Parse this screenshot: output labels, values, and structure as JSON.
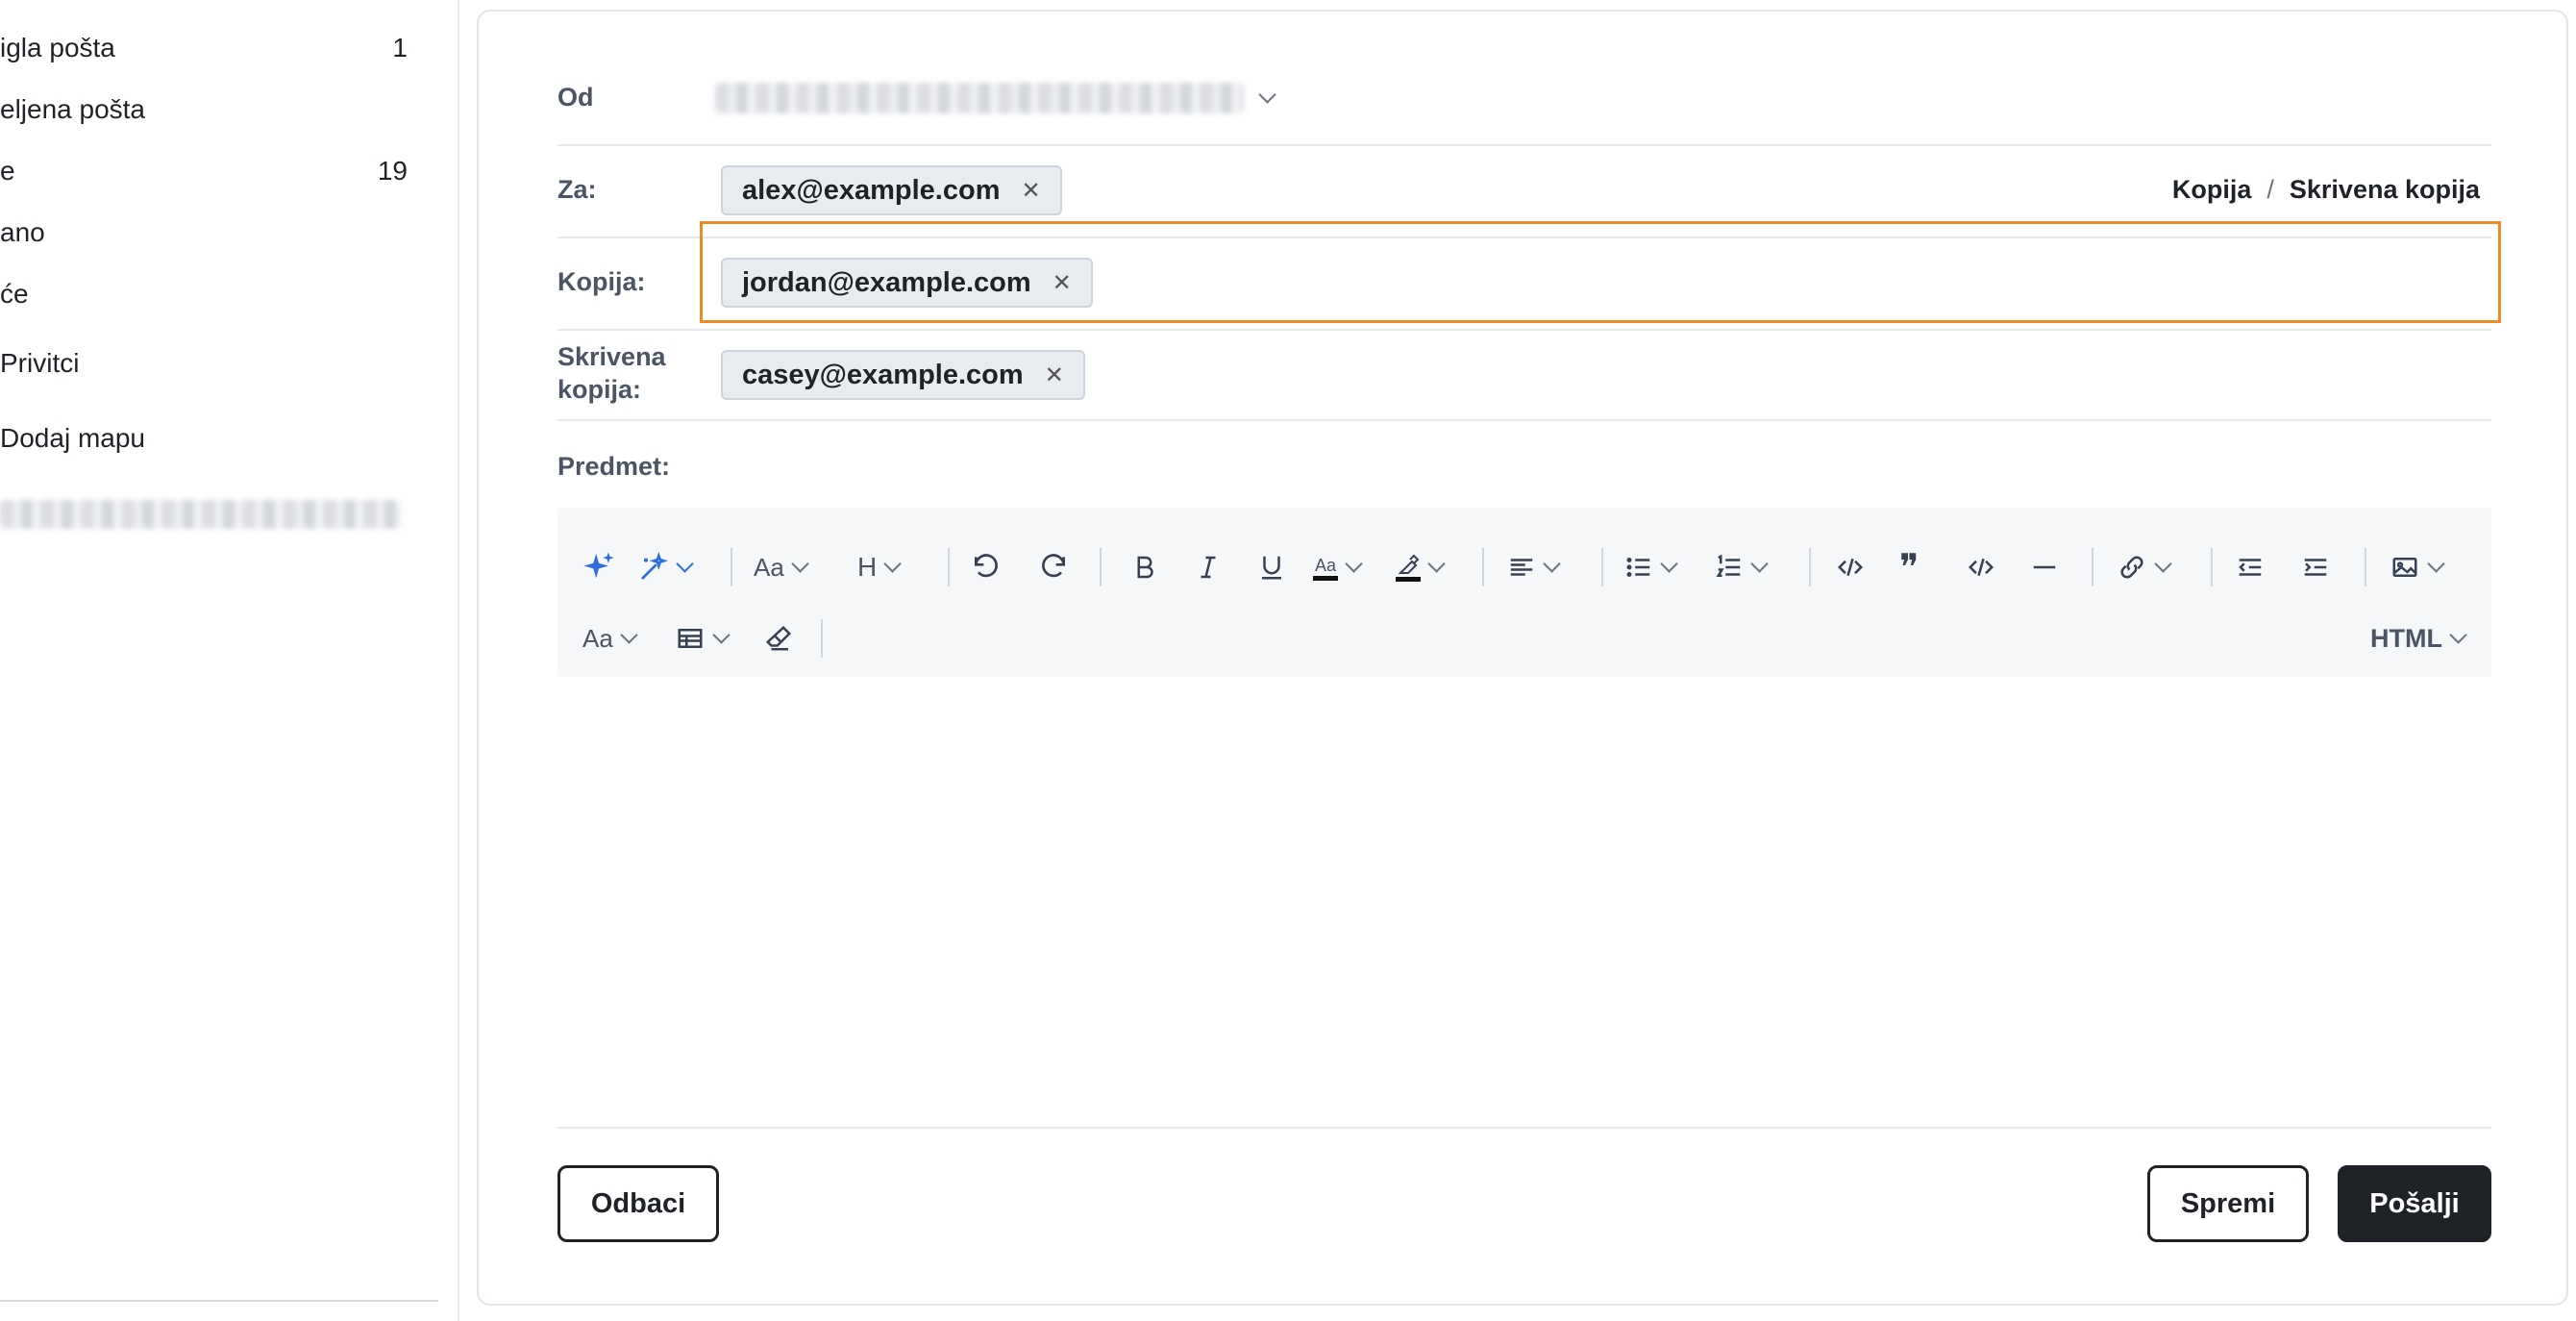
{
  "sidebar": {
    "items": [
      {
        "label": "igla pošta",
        "count": "1"
      },
      {
        "label": "eljena pošta",
        "count": ""
      },
      {
        "label": "e",
        "count": "19"
      },
      {
        "label": "ano",
        "count": ""
      },
      {
        "label": "će",
        "count": ""
      },
      {
        "label": "Privitci",
        "count": ""
      },
      {
        "label": "Dodaj mapu",
        "count": ""
      }
    ]
  },
  "compose": {
    "from_label": "Od",
    "to_label": "Za:",
    "to_recipients": [
      "alex@example.com"
    ],
    "cc_toggle": "Kopija",
    "cc_separator": "/",
    "bcc_toggle": "Skrivena kopija",
    "cc_label": "Kopija:",
    "cc_recipients": [
      "jordan@example.com"
    ],
    "bcc_label_line1": "Skrivena",
    "bcc_label_line2": "kopija:",
    "bcc_recipients": [
      "casey@example.com"
    ],
    "subject_label": "Predmet:",
    "subject_value": ""
  },
  "toolbar": {
    "font_size_label": "Aa",
    "heading_label": "H",
    "format_label": "HTML"
  },
  "actions": {
    "discard": "Odbaci",
    "save": "Spremi",
    "send": "Pošalji"
  },
  "colors": {
    "accent_highlight": "#f08a24",
    "ai_icon": "#2f6fdb",
    "primary_button": "#1f2328"
  }
}
